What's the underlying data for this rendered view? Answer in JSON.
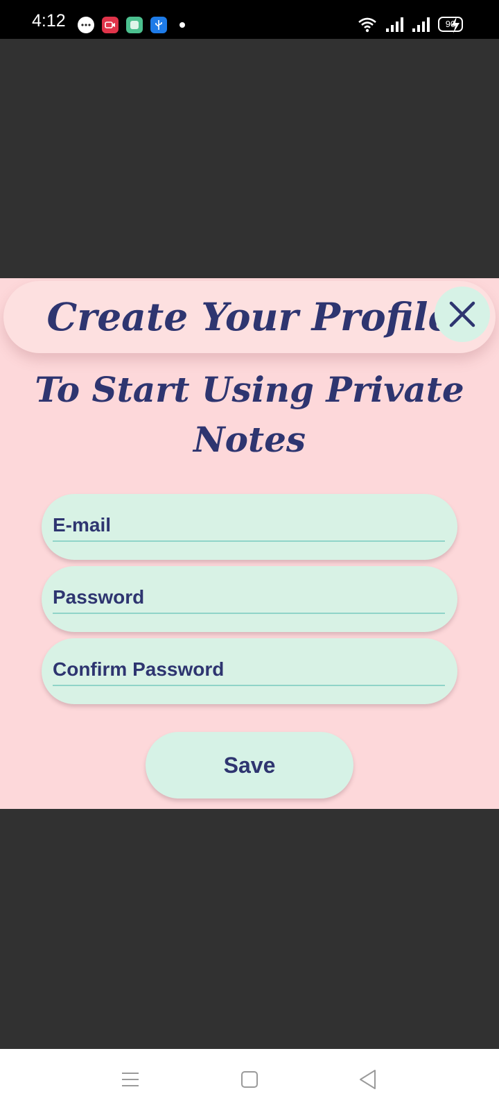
{
  "status_bar": {
    "time": "4:12",
    "battery": "90",
    "icons": [
      "message-icon",
      "screen-record-icon",
      "gallery-icon",
      "usb-icon",
      "wifi-icon",
      "signal-icon",
      "signal-icon",
      "charging-icon"
    ]
  },
  "modal": {
    "title": "Create Your Profile",
    "subtitle": "To Start Using Private Notes",
    "fields": {
      "email": {
        "placeholder": "E-mail",
        "value": ""
      },
      "password": {
        "placeholder": "Password",
        "value": ""
      },
      "confirm_password": {
        "placeholder": "Confirm Password",
        "value": ""
      }
    },
    "save_label": "Save"
  },
  "colors": {
    "background": "#313131",
    "panel": "#fdd8da",
    "accent_text": "#2e3570",
    "input_fill": "#d8f2e5",
    "input_underline": "#8fd4c8"
  }
}
